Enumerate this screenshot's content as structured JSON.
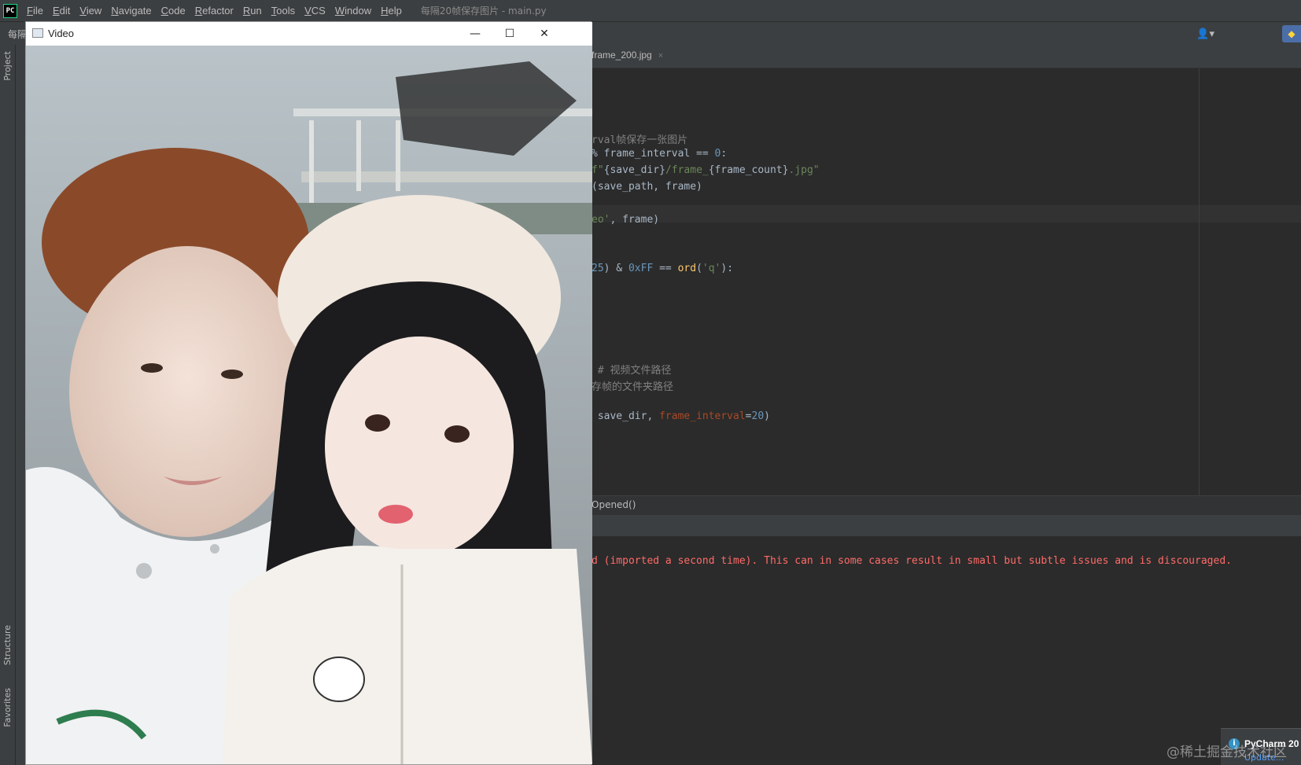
{
  "menubar": {
    "logo": "PC",
    "items": [
      "File",
      "Edit",
      "View",
      "Navigate",
      "Code",
      "Refactor",
      "Run",
      "Tools",
      "VCS",
      "Window",
      "Help"
    ],
    "window_title": "每隔20帧保存图片 - main.py"
  },
  "toolbar": {
    "crumb": "每隔"
  },
  "left_strip": {
    "project": "Project",
    "structure": "Structure",
    "favorites": "Favorites"
  },
  "editor": {
    "tab": "frame_200.jpg",
    "tab_close": "×",
    "lines": [
      {
        "seg": [
          {
            "t": "rval帧保存一张图片",
            "c": "comment"
          }
        ]
      },
      {
        "seg": [
          {
            "t": "% frame_interval == ",
            "c": "fvar"
          },
          {
            "t": "0",
            "c": "kw-blue"
          },
          {
            "t": ":",
            "c": "fvar"
          }
        ]
      },
      {
        "seg": [
          {
            "t": "f\"",
            "c": "str-green"
          },
          {
            "t": "{save_dir}",
            "c": "fvar"
          },
          {
            "t": "/frame_",
            "c": "str-green"
          },
          {
            "t": "{frame_count}",
            "c": "fvar"
          },
          {
            "t": ".jpg\"",
            "c": "str-green"
          }
        ]
      },
      {
        "seg": [
          {
            "t": "(save_path, frame)",
            "c": "fvar"
          }
        ]
      },
      {
        "seg": [
          {
            "t": "eo'",
            "c": "str-green"
          },
          {
            "t": ", frame)",
            "c": "fvar"
          }
        ]
      },
      {
        "seg": [
          {
            "t": "25",
            "c": "kw-blue"
          },
          {
            "t": ") & ",
            "c": "fvar"
          },
          {
            "t": "0xFF",
            "c": "kw-blue"
          },
          {
            "t": " == ",
            "c": "fvar"
          },
          {
            "t": "ord",
            "c": "func"
          },
          {
            "t": "(",
            "c": "fvar"
          },
          {
            "t": "'q'",
            "c": "str-green"
          },
          {
            "t": "):",
            "c": "fvar"
          }
        ]
      },
      {
        "seg": [
          {
            "t": " # 视频文件路径",
            "c": "comment"
          }
        ]
      },
      {
        "seg": [
          {
            "t": "存帧的文件夹路径",
            "c": "comment"
          }
        ]
      },
      {
        "seg": [
          {
            "t": " save_dir, ",
            "c": "fvar"
          },
          {
            "t": "frame_interval",
            "c": "param"
          },
          {
            "t": "=",
            "c": "fvar"
          },
          {
            "t": "20",
            "c": "kw-blue"
          },
          {
            "t": ")",
            "c": "fvar"
          }
        ]
      }
    ]
  },
  "breadcrumb": "Opened()",
  "console": {
    "error_line": "d (imported a second time). This can in some cases result in small but subtle issues and is discouraged."
  },
  "notification": {
    "title": "PyCharm 20",
    "link": "Update..."
  },
  "watermark": "@稀土掘金技术社区",
  "video_window": {
    "title": "Video",
    "minimize": "—",
    "maximize": "☐",
    "close": "✕"
  }
}
